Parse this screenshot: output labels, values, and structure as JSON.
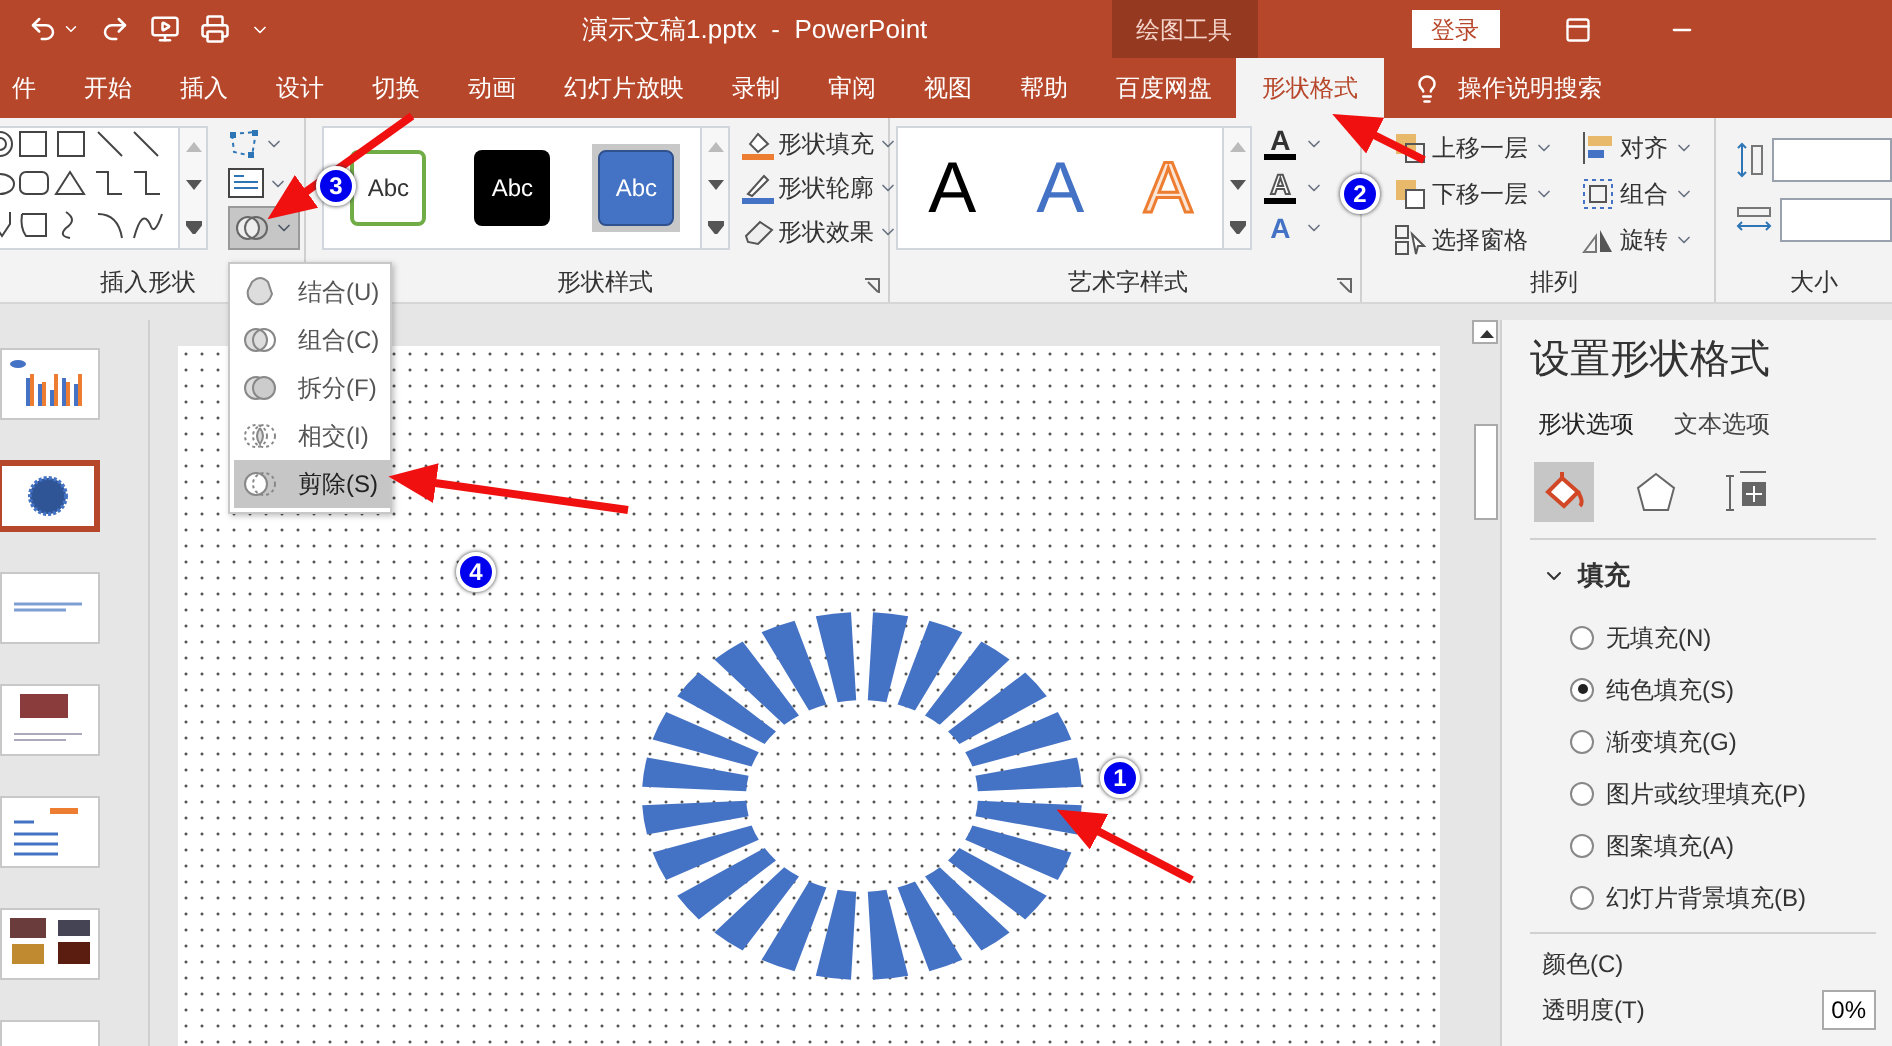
{
  "title_bar": {
    "title": "演示文稿1.pptx  -  PowerPoint",
    "context_tab": "绘图工具",
    "sign_in": "登录"
  },
  "tabs": [
    {
      "label": "件",
      "selected": false
    },
    {
      "label": "开始",
      "selected": false
    },
    {
      "label": "插入",
      "selected": false
    },
    {
      "label": "设计",
      "selected": false
    },
    {
      "label": "切换",
      "selected": false
    },
    {
      "label": "动画",
      "selected": false
    },
    {
      "label": "幻灯片放映",
      "selected": false
    },
    {
      "label": "录制",
      "selected": false
    },
    {
      "label": "审阅",
      "selected": false
    },
    {
      "label": "视图",
      "selected": false
    },
    {
      "label": "帮助",
      "selected": false
    },
    {
      "label": "百度网盘",
      "selected": false
    },
    {
      "label": "形状格式",
      "selected": true
    }
  ],
  "tell_me": "操作说明搜索",
  "insert_shapes": {
    "label": "插入形状"
  },
  "merge_menu": {
    "items": [
      {
        "label": "结合(U)",
        "selected": false
      },
      {
        "label": "组合(C)",
        "selected": false
      },
      {
        "label": "拆分(F)",
        "selected": false
      },
      {
        "label": "相交(I)",
        "selected": false
      },
      {
        "label": "剪除(S)",
        "selected": true
      }
    ]
  },
  "shape_styles": {
    "label": "形状样式",
    "presets": [
      {
        "text": "Abc",
        "kind": "outline",
        "selected": false
      },
      {
        "text": "Abc",
        "kind": "dark",
        "selected": false
      },
      {
        "text": "Abc",
        "kind": "blue",
        "selected": true
      }
    ],
    "commands": [
      {
        "label": "形状填充",
        "kind": "fill"
      },
      {
        "label": "形状轮廓",
        "kind": "outline"
      },
      {
        "label": "形状效果",
        "kind": "effects"
      }
    ]
  },
  "wordart": {
    "label": "艺术字样式",
    "presets": [
      {
        "text": "A",
        "kind": "black"
      },
      {
        "text": "A",
        "kind": "blue"
      },
      {
        "text": "A",
        "kind": "orange"
      }
    ],
    "tools": [
      {
        "text": "A",
        "kind": "fill"
      },
      {
        "text": "A",
        "kind": "outline"
      },
      {
        "text": "A",
        "kind": "effects"
      }
    ]
  },
  "arrange": {
    "label": "排列",
    "commands": [
      {
        "label": "上移一层",
        "kind": "forward"
      },
      {
        "label": "对齐",
        "kind": "align"
      },
      {
        "label": "下移一层",
        "kind": "backward"
      },
      {
        "label": "组合",
        "kind": "group"
      },
      {
        "label": "选择窗格",
        "kind": "pane"
      },
      {
        "label": "旋转",
        "kind": "rotate"
      }
    ]
  },
  "size": {
    "label": "大小"
  },
  "slides": [
    {
      "kind": "chart",
      "selected": false
    },
    {
      "kind": "shape",
      "selected": true
    },
    {
      "kind": "text",
      "selected": false
    },
    {
      "kind": "photo",
      "selected": false
    },
    {
      "kind": "agenda",
      "selected": false
    },
    {
      "kind": "gallery",
      "selected": false
    },
    {
      "kind": "blank",
      "selected": false
    }
  ],
  "format_pane": {
    "title": "设置形状格式",
    "tabs": [
      {
        "label": "形状选项",
        "selected": true
      },
      {
        "label": "文本选项",
        "selected": false
      }
    ],
    "icon_tabs": [
      {
        "kind": "fill",
        "selected": true
      },
      {
        "kind": "effects",
        "selected": false
      },
      {
        "kind": "size",
        "selected": false
      }
    ],
    "section": {
      "label": "填充",
      "expanded": true
    },
    "options": [
      {
        "label": "无填充(N)",
        "selected": false
      },
      {
        "label": "纯色填充(S)",
        "selected": true
      },
      {
        "label": "渐变填充(G)",
        "selected": false
      },
      {
        "label": "图片或纹理填充(P)",
        "selected": false
      },
      {
        "label": "图案填充(A)",
        "selected": false
      },
      {
        "label": "幻灯片背景填充(B)",
        "selected": false
      }
    ],
    "color_label": "颜色(C)",
    "transparency_label": "透明度(T)",
    "transparency_value": "0%"
  },
  "annotations": [
    {
      "number": "1"
    },
    {
      "number": "2"
    },
    {
      "number": "3"
    },
    {
      "number": "4"
    }
  ]
}
